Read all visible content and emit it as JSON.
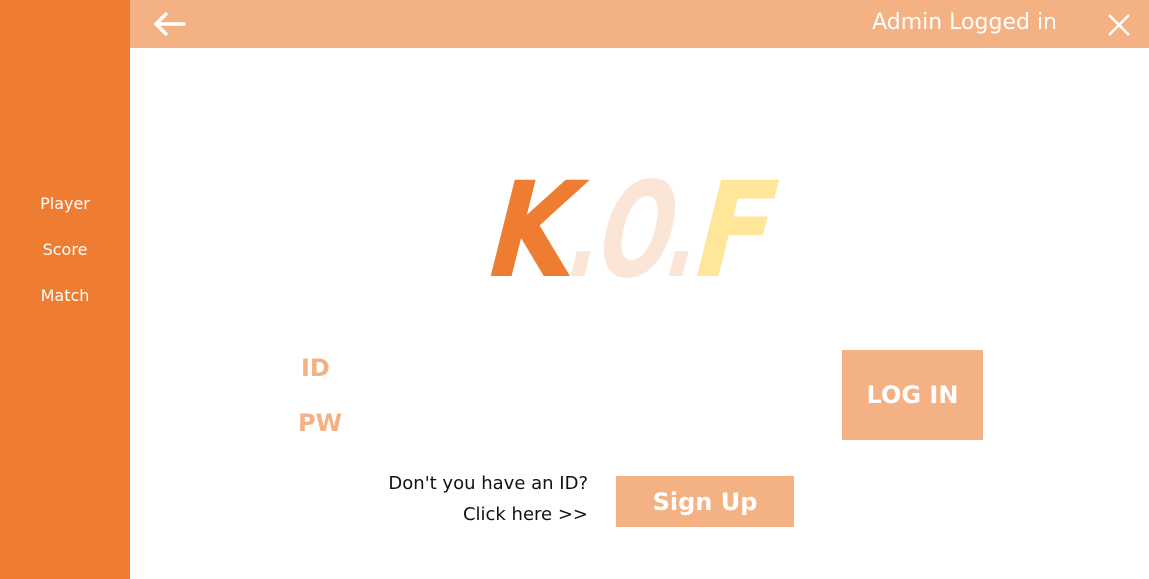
{
  "sidebar": {
    "items": [
      {
        "label": "Player"
      },
      {
        "label": "Score"
      },
      {
        "label": "Match"
      }
    ]
  },
  "topbar": {
    "back_icon": "arrow-left-icon",
    "status": "Admin Logged in",
    "close_icon": "close-icon"
  },
  "logo": {
    "text": "K.O.F",
    "colors": [
      "#ee7d32",
      "#fbe5d6",
      "#ffe699"
    ]
  },
  "form": {
    "id_label": "ID",
    "id_value": "",
    "pw_label": "PW",
    "pw_value": "",
    "login_label": "LOG IN"
  },
  "signup": {
    "hint_line1": "Don't you have an ID?",
    "hint_line2": "Click here >>",
    "button_label": "Sign Up"
  },
  "colors": {
    "sidebar": "#ee7d32",
    "accent": "#f4b183",
    "text_white": "#ffffff"
  }
}
